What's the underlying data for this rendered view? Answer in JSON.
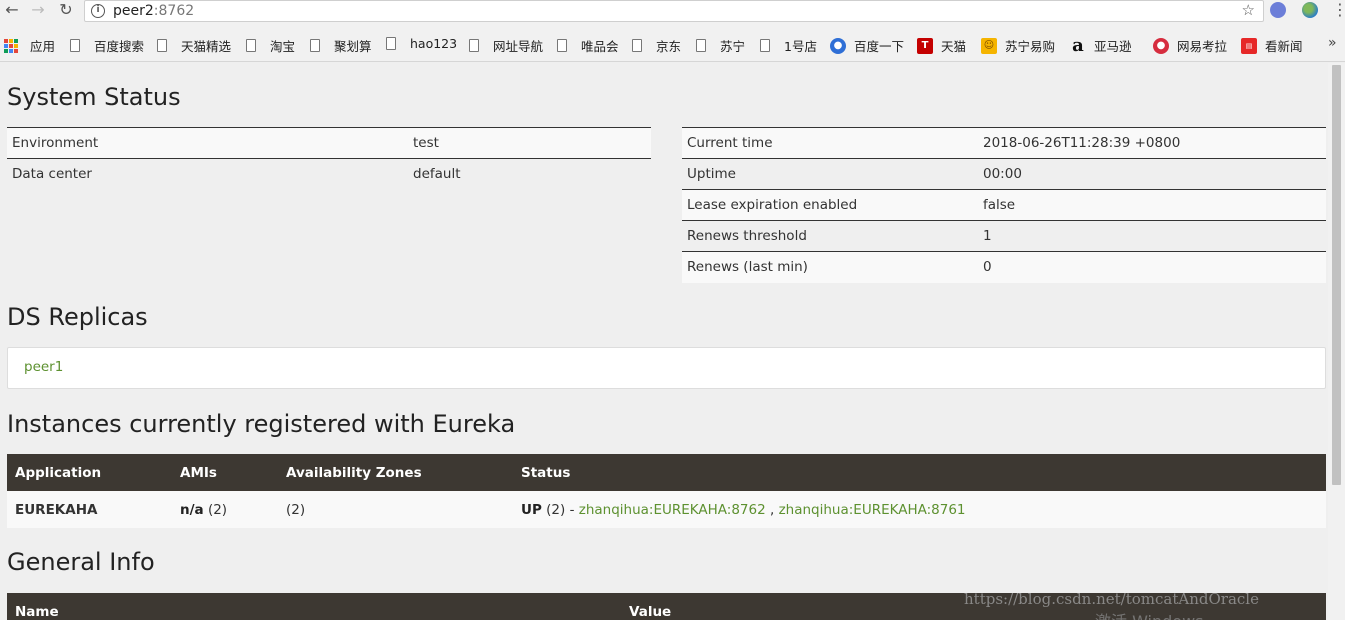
{
  "browser": {
    "url_host": "peer2",
    "url_port": ":8762",
    "more_label": "»",
    "bookmarks": [
      {
        "label": "应用",
        "icon": "apps-grid-icon"
      },
      {
        "label": "百度搜索",
        "icon": "page-icon"
      },
      {
        "label": "天猫精选",
        "icon": "page-icon"
      },
      {
        "label": "淘宝",
        "icon": "page-icon"
      },
      {
        "label": "聚划算",
        "icon": "page-icon"
      },
      {
        "label": "hao123",
        "icon": "page-icon"
      },
      {
        "label": "网址导航",
        "icon": "page-icon"
      },
      {
        "label": "唯品会",
        "icon": "page-icon"
      },
      {
        "label": "京东",
        "icon": "page-icon"
      },
      {
        "label": "苏宁",
        "icon": "page-icon"
      },
      {
        "label": "1号店",
        "icon": "page-icon"
      },
      {
        "label": "百度一下",
        "icon": "baidu-paw-icon"
      },
      {
        "label": "天猫",
        "icon": "tmall-icon"
      },
      {
        "label": "苏宁易购",
        "icon": "suning-icon"
      },
      {
        "label": "亚马逊",
        "icon": "amazon-icon"
      },
      {
        "label": "网易考拉",
        "icon": "kaola-icon"
      },
      {
        "label": "看新闻",
        "icon": "toutiao-icon"
      }
    ]
  },
  "system_status": {
    "title": "System Status",
    "left": [
      {
        "key": "Environment",
        "value": "test"
      },
      {
        "key": "Data center",
        "value": "default"
      }
    ],
    "right": [
      {
        "key": "Current time",
        "value": "2018-06-26T11:28:39 +0800"
      },
      {
        "key": "Uptime",
        "value": "00:00"
      },
      {
        "key": "Lease expiration enabled",
        "value": "false"
      },
      {
        "key": "Renews threshold",
        "value": "1"
      },
      {
        "key": "Renews (last min)",
        "value": "0"
      }
    ]
  },
  "replicas": {
    "title": "DS Replicas",
    "items": [
      "peer1"
    ]
  },
  "instances": {
    "title": "Instances currently registered with Eureka",
    "headers": [
      "Application",
      "AMIs",
      "Availability Zones",
      "Status"
    ],
    "rows": [
      {
        "application": "EUREKAHA",
        "amis_bold": "n/a",
        "amis_count": " (2)",
        "zones": "(2)",
        "status_bold": "UP",
        "status_count": " (2) - ",
        "link1": "zhanqihua:EUREKAHA:8762",
        "separator": " , ",
        "link2": "zhanqihua:EUREKAHA:8761"
      }
    ]
  },
  "general_info": {
    "title": "General Info",
    "headers": [
      "Name",
      "Value"
    ]
  },
  "overlays": {
    "watermark": "https://blog.csdn.net/tomcatAndOracle",
    "activate": "激活 Windows"
  }
}
